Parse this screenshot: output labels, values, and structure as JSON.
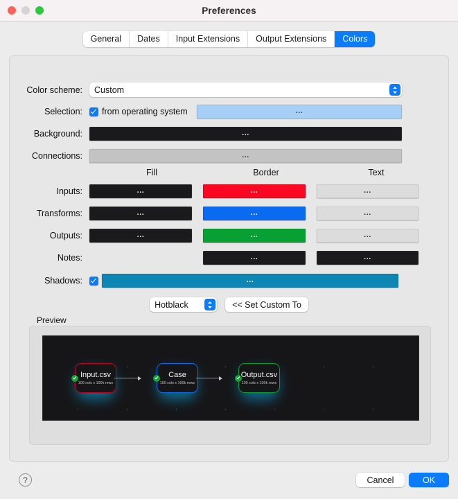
{
  "window": {
    "title": "Preferences",
    "traffic_lights": [
      "close",
      "minimize",
      "zoom"
    ]
  },
  "tabs": [
    {
      "label": "General",
      "active": false
    },
    {
      "label": "Dates",
      "active": false
    },
    {
      "label": "Input Extensions",
      "active": false
    },
    {
      "label": "Output Extensions",
      "active": false
    },
    {
      "label": "Colors",
      "active": true
    }
  ],
  "form": {
    "color_scheme": {
      "label": "Color scheme:",
      "value": "Custom"
    },
    "selection": {
      "label": "Selection:",
      "checkbox_label": "from operating system",
      "checked": true,
      "swatch_color": "#a8d0f7",
      "swatch_dots": "..."
    },
    "background": {
      "label": "Background:",
      "swatch_color": "#1a1a1c",
      "swatch_dots": "..."
    },
    "connections": {
      "label": "Connections:",
      "swatch_color": "#c3c3c3",
      "swatch_dots": "..."
    }
  },
  "grid": {
    "columns": [
      "Fill",
      "Border",
      "Text"
    ],
    "rows": [
      {
        "label": "Inputs:",
        "fill": "#1a1a1c",
        "border": "#fa0822",
        "text": "#dcdcdc",
        "fill_kind": "dark",
        "border_kind": "tinted",
        "text_kind": "light"
      },
      {
        "label": "Transforms:",
        "fill": "#1a1a1c",
        "border": "#0a6af0",
        "text": "#dcdcdc",
        "fill_kind": "dark",
        "border_kind": "tinted",
        "text_kind": "light"
      },
      {
        "label": "Outputs:",
        "fill": "#1a1a1c",
        "border": "#06a033",
        "text": "#dcdcdc",
        "fill_kind": "dark",
        "border_kind": "tinted",
        "text_kind": "light"
      },
      {
        "label": "Notes:",
        "fill": null,
        "border": "#1a1a1c",
        "text": "#1a1a1c",
        "fill_kind": "none",
        "border_kind": "dark",
        "text_kind": "dark"
      }
    ],
    "shadows": {
      "label": "Shadows:",
      "checked": true,
      "swatch_color": "#0d86b4",
      "swatch_dots": "..."
    },
    "swatch_dots": "..."
  },
  "preset": {
    "value": "Hotblack",
    "apply_button": "<< Set Custom To"
  },
  "preview": {
    "label": "Preview",
    "nodes": [
      {
        "name": "Input.csv",
        "subtitle": "100 cols x 100k rows",
        "border_color": "#c3001f",
        "status": "ok"
      },
      {
        "name": "Case",
        "subtitle": "100 cols x 100k rows",
        "border_color": "#0a6af0",
        "status": "ok"
      },
      {
        "name": "Output.csv",
        "subtitle": "100 cols x 100k rows",
        "border_color": "#06a033",
        "status": "ok"
      }
    ]
  },
  "footer": {
    "help": "?",
    "cancel": "Cancel",
    "ok": "OK"
  }
}
